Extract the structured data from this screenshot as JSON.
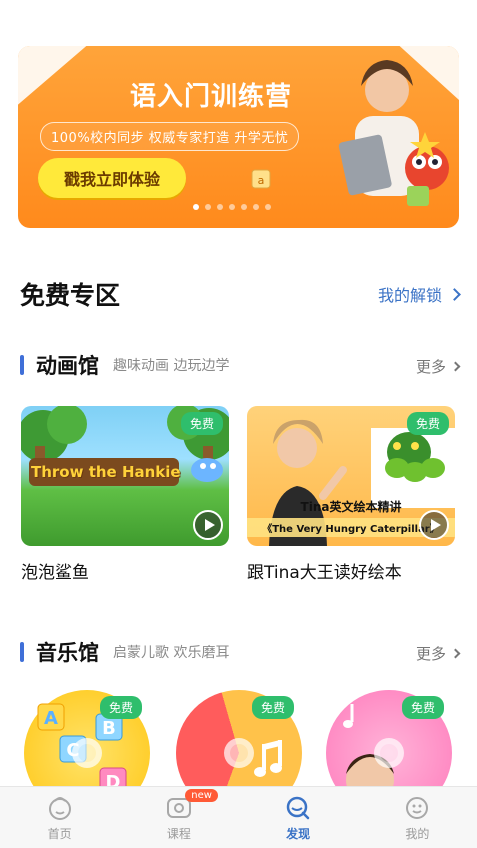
{
  "banner": {
    "title": "语入门训练营",
    "subtitle": "100%校内同步  权威专家打造  升学无忧",
    "cta_label": "戳我立即体验",
    "dot_count": 7,
    "active_dot": 0
  },
  "free_zone": {
    "title": "免费专区",
    "my_unlock_label": "我的解锁"
  },
  "animation_hall": {
    "title": "动画馆",
    "subtitle": "趣味动画 边玩边学",
    "more_label": "更多",
    "cards": [
      {
        "label": "泡泡鲨鱼",
        "badge": "免费",
        "thumb_caption": "Throw the Hankie"
      },
      {
        "label": "跟Tina大王读好绘本",
        "badge": "免费",
        "thumb_caption_1": "Tina英文绘本精讲",
        "thumb_caption_2": "《The Very Hungry Caterpillar》"
      }
    ]
  },
  "music_hall": {
    "title": "音乐馆",
    "subtitle": "启蒙儿歌 欢乐磨耳",
    "more_label": "更多",
    "cards": [
      {
        "badge": "免费"
      },
      {
        "badge": "免费"
      },
      {
        "badge": "免费"
      }
    ]
  },
  "tabbar": {
    "items": [
      {
        "label": "首页",
        "icon": "home-face-icon"
      },
      {
        "label": "课程",
        "icon": "course-play-icon",
        "badge": "new"
      },
      {
        "label": "发现",
        "icon": "discover-search-icon",
        "active": true
      },
      {
        "label": "我的",
        "icon": "profile-face-icon"
      }
    ]
  },
  "colors": {
    "accent": "#3b73c6",
    "banner_orange": "#ff8a1c",
    "cta_yellow": "#ffe93a",
    "free_badge": "#2fbe6c",
    "section_bar": "#3f6fd8",
    "new_badge": "#ff5a36"
  }
}
